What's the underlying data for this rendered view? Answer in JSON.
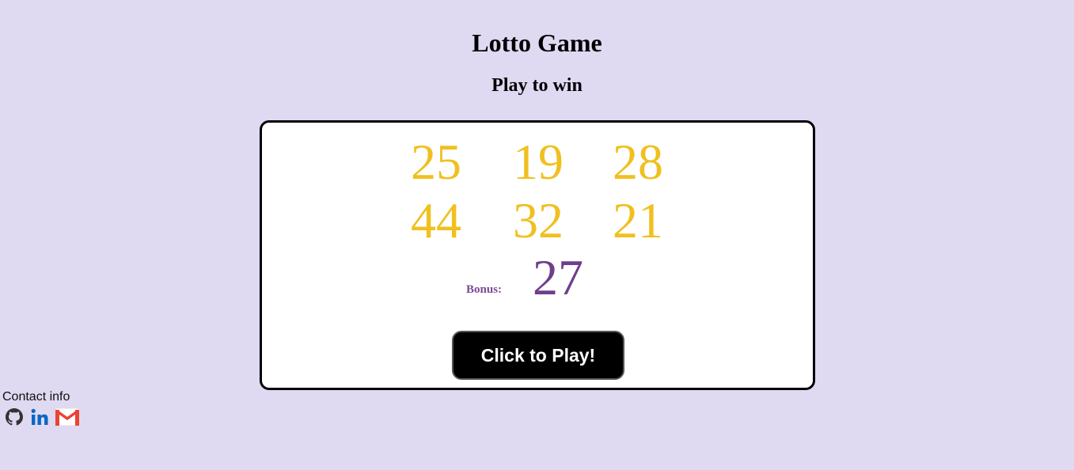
{
  "header": {
    "title": "Lotto Game",
    "subtitle": "Play to win"
  },
  "lotto": {
    "numbers": [
      "25",
      "19",
      "28",
      "44",
      "32",
      "21"
    ],
    "bonus_label": "Bonus:",
    "bonus_number": "27",
    "number_color": "#f0c020",
    "bonus_color": "#6f3f8a",
    "play_button_label": "Click to Play!"
  },
  "contact": {
    "label": "Contact info",
    "links": [
      {
        "icon": "github-icon"
      },
      {
        "icon": "linkedin-icon"
      },
      {
        "icon": "gmail-icon"
      }
    ]
  },
  "colors": {
    "background": "#dfd9f1",
    "card_background": "#ffffff",
    "button_background": "#000000",
    "linkedin_blue": "#0a66c2",
    "gmail_red": "#ea4335"
  }
}
